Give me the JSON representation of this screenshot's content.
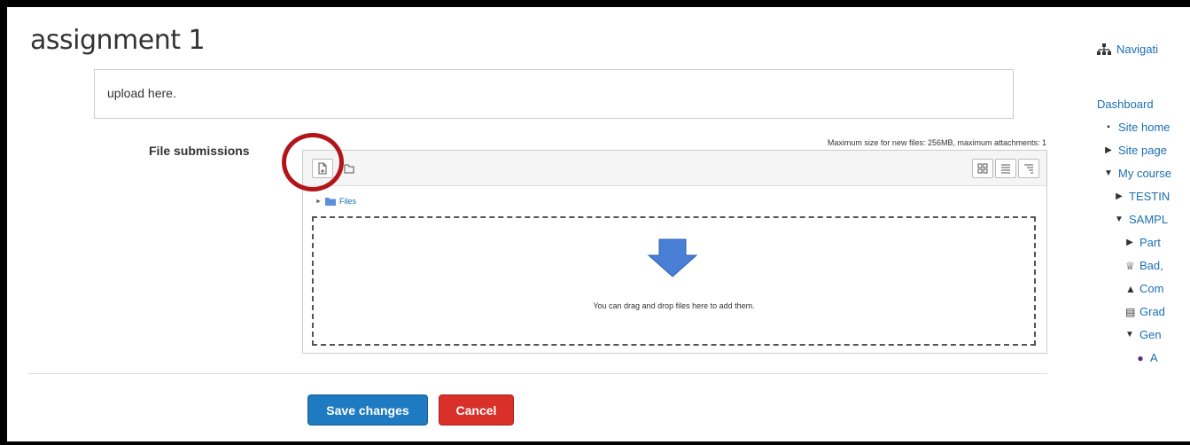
{
  "page": {
    "title": "assignment 1"
  },
  "online_text": {
    "value": "upload here."
  },
  "file_submissions": {
    "label": "File submissions",
    "max_size_text": "Maximum size for new files: 256MB, maximum attachments: 1",
    "path_label": "Files",
    "drop_text": "You can drag and drop files here to add them."
  },
  "buttons": {
    "save": "Save changes",
    "cancel": "Cancel"
  },
  "navigation": {
    "title": "Navigati",
    "items": [
      {
        "label": "Dashboard",
        "icon": ""
      },
      {
        "label": "Site home",
        "icon": "bullet-icon"
      },
      {
        "label": "Site page",
        "icon": "triangle-right-icon"
      },
      {
        "label": "My course",
        "icon": "triangle-down-icon"
      },
      {
        "label": "TESTIN",
        "icon": "triangle-right-icon"
      },
      {
        "label": "SAMPL",
        "icon": "triangle-down-icon"
      },
      {
        "label": "Part",
        "icon": "triangle-right-icon"
      },
      {
        "label": "Bad,",
        "icon": "trophy-icon"
      },
      {
        "label": "Com",
        "icon": "competency-icon"
      },
      {
        "label": "Grad",
        "icon": "grades-icon"
      },
      {
        "label": "Gen",
        "icon": "triangle-down-icon"
      },
      {
        "label": "A",
        "icon": "forum-icon"
      }
    ]
  },
  "colors": {
    "save_button": "#1f7bc1",
    "cancel_button": "#d9302a",
    "highlight": "#b3141a",
    "link": "#1a6fb5",
    "drop_arrow": "#4a7fd6"
  }
}
